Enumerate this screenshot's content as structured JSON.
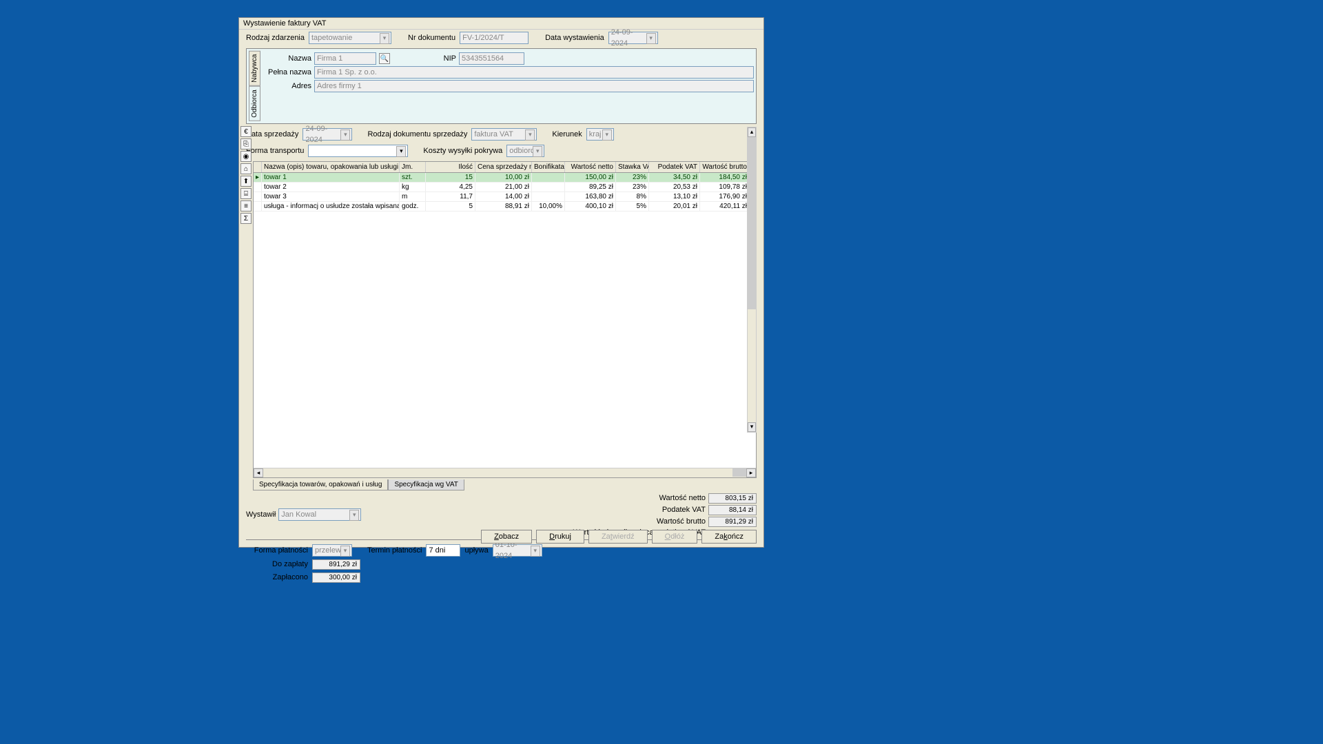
{
  "title": "Wystawienie faktury VAT",
  "top": {
    "rodzaj_zdarzenia_label": "Rodzaj zdarzenia",
    "rodzaj_zdarzenia_value": "tapetowanie",
    "nr_dokumentu_label": "Nr dokumentu",
    "nr_dokumentu_value": "FV-1/2024/T",
    "data_wystawienia_label": "Data wystawienia",
    "data_wystawienia_value": "24-09-2024"
  },
  "party": {
    "tab_odbiorca": "Odbiorca",
    "tab_nabywca": "Nabywca",
    "nazwa_label": "Nazwa",
    "nazwa_value": "Firma 1",
    "nip_label": "NIP",
    "nip_value": "5343551564",
    "pelna_label": "Pełna nazwa",
    "pelna_value": "Firma 1 Sp. z o.o.",
    "adres_label": "Adres",
    "adres_value": "Adres firmy 1"
  },
  "mid": {
    "data_sprzedazy_label": "Data sprzedaży",
    "data_sprzedazy_value": "24-09-2024",
    "rodzaj_dok_label": "Rodzaj dokumentu sprzedaży",
    "rodzaj_dok_value": "faktura VAT",
    "kierunek_label": "Kierunek",
    "kierunek_value": "kraj",
    "forma_transportu_label": "Forma transportu",
    "koszty_label": "Koszty wysyłki pokrywa",
    "koszty_value": "odbiorca"
  },
  "grid": {
    "headers": {
      "name": "Nazwa (opis) towaru, opakowania lub usługi",
      "jm": "Jm.",
      "qty": "Ilość",
      "price": "Cena sprzedaży netto",
      "bon": "Bonifikata",
      "net": "Wartość netto",
      "rate": "Stawka VAT",
      "vat": "Podatek VAT",
      "gross": "Wartość brutto"
    },
    "rows": [
      {
        "name": "towar 1",
        "jm": "szt.",
        "qty": "15",
        "price": "10,00 zł",
        "bon": "",
        "net": "150,00 zł",
        "rate": "23%",
        "vat": "34,50 zł",
        "gross": "184,50 zł"
      },
      {
        "name": "towar 2",
        "jm": "kg",
        "qty": "4,25",
        "price": "21,00 zł",
        "bon": "",
        "net": "89,25 zł",
        "rate": "23%",
        "vat": "20,53 zł",
        "gross": "109,78 zł"
      },
      {
        "name": "towar 3",
        "jm": "m",
        "qty": "11,7",
        "price": "14,00 zł",
        "bon": "",
        "net": "163,80 zł",
        "rate": "8%",
        "vat": "13,10 zł",
        "gross": "176,90 zł"
      },
      {
        "name": "usługa - informacj o usłudze została wpisana bezpośr",
        "jm": "godz.",
        "qty": "5",
        "price": "88,91 zł",
        "bon": "10,00%",
        "net": "400,10 zł",
        "rate": "5%",
        "vat": "20,01 zł",
        "gross": "420,11 zł"
      }
    ]
  },
  "tabs": {
    "tab1": "Specyfikacja towarów, opakowań i usług",
    "tab2": "Specyfikacja wg VAT"
  },
  "issuer": {
    "label": "Wystawił",
    "value": "Jan Kowal"
  },
  "totals": {
    "net_label": "Wartość netto",
    "net_value": "803,15 zł",
    "vat_label": "Podatek VAT",
    "vat_value": "88,14 zł",
    "gross_label": "Wartość brutto",
    "gross_value": "891,29 zł",
    "nontax_label": "Wartość niepodlegająca podatkowi VAT"
  },
  "payment": {
    "forma_label": "Forma płatności",
    "forma_value": "przelew",
    "termin_label": "Termin płatności",
    "termin_value": "7 dni",
    "uplywa_label": "upływa",
    "uplywa_value": "01-10-2024",
    "do_zaplaty_label": "Do zapłaty",
    "do_zaplaty_value": "891,29 zł",
    "zaplacono_label": "Zapłacono",
    "zaplacono_value": "300,00 zł"
  },
  "buttons": {
    "zobacz": "Zobacz",
    "drukuj": "Drukuj",
    "zatwierdz": "Zatwierdź",
    "odroz": "Odłóż",
    "zakoncz": "Zakończ"
  },
  "icons": [
    "€",
    "⎘",
    "◉",
    "⌂",
    "⬆",
    "⌸",
    "≡",
    "Σ"
  ]
}
